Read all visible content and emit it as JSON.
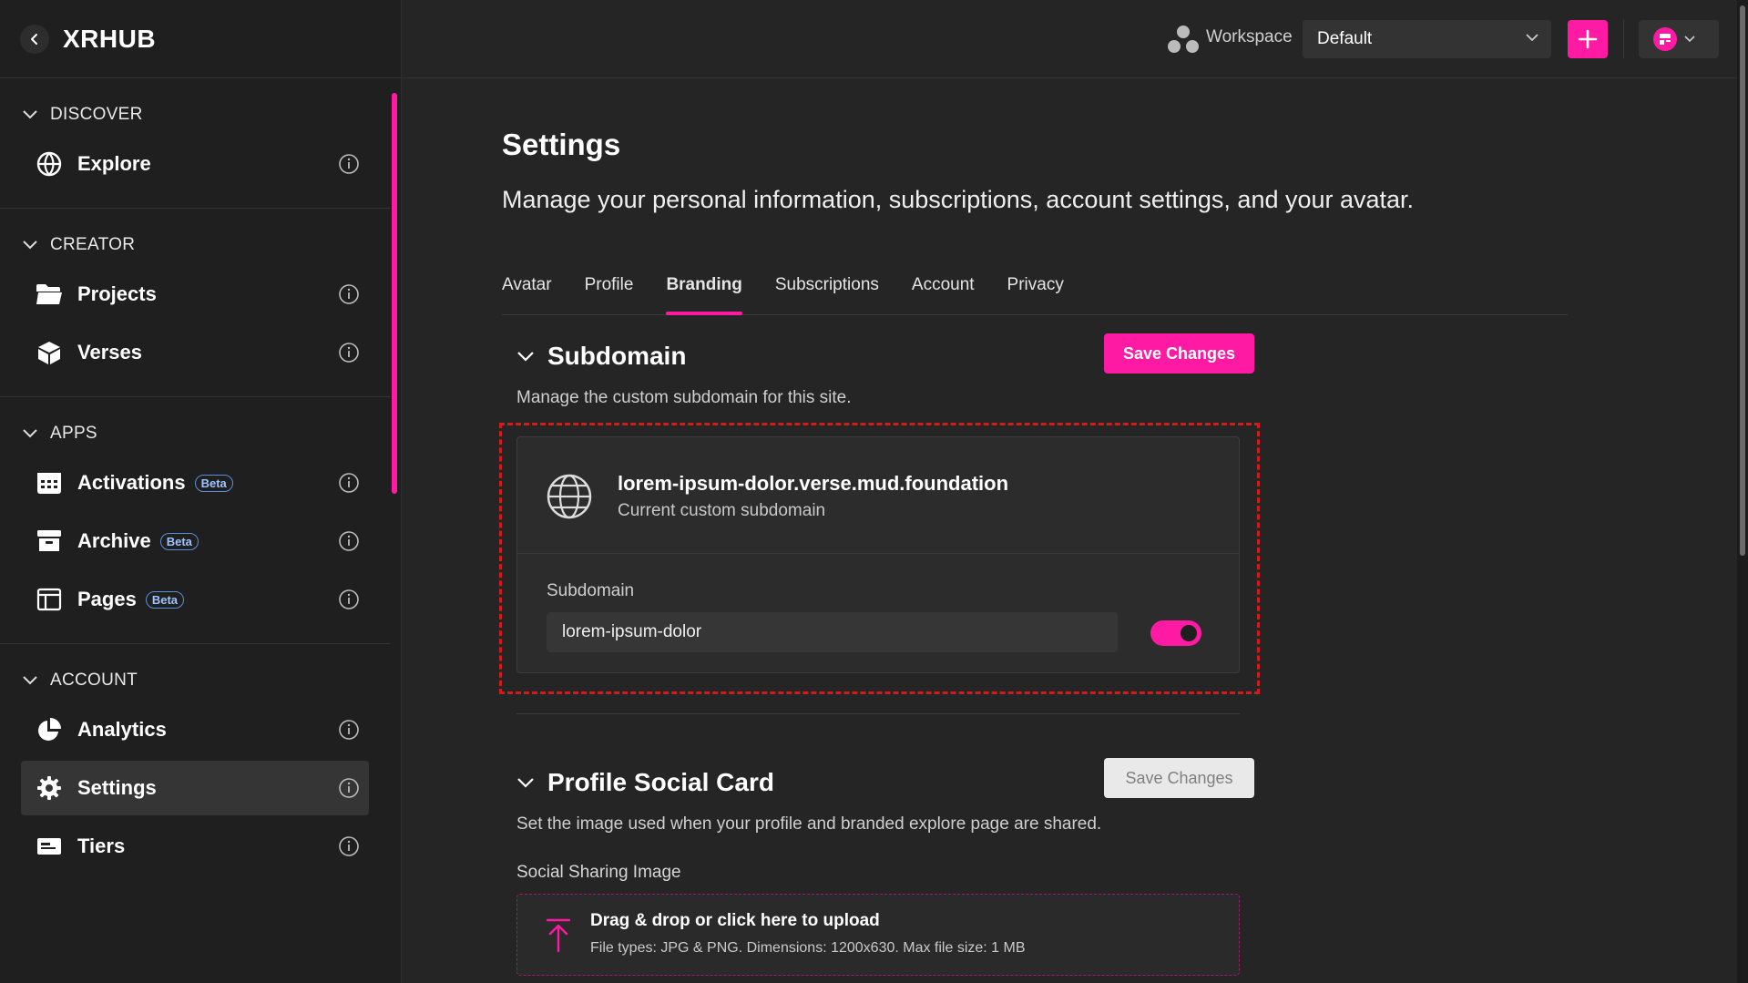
{
  "app": {
    "brand": "XRHUB"
  },
  "header": {
    "workspace_label": "Workspace",
    "workspace_value": "Default"
  },
  "sidebar": {
    "sections": [
      {
        "title": "DISCOVER",
        "items": [
          {
            "label": "Explore",
            "icon": "globe-icon"
          }
        ]
      },
      {
        "title": "CREATOR",
        "items": [
          {
            "label": "Projects",
            "icon": "folder-icon"
          },
          {
            "label": "Verses",
            "icon": "cube-icon"
          }
        ]
      },
      {
        "title": "APPS",
        "items": [
          {
            "label": "Activations",
            "icon": "calendar-grid-icon",
            "badge": "Beta"
          },
          {
            "label": "Archive",
            "icon": "archive-icon",
            "badge": "Beta"
          },
          {
            "label": "Pages",
            "icon": "layout-icon",
            "badge": "Beta"
          }
        ]
      },
      {
        "title": "ACCOUNT",
        "items": [
          {
            "label": "Analytics",
            "icon": "pie-chart-icon"
          },
          {
            "label": "Settings",
            "icon": "gear-icon",
            "active": true
          },
          {
            "label": "Tiers",
            "icon": "ticket-icon"
          }
        ]
      }
    ]
  },
  "main": {
    "title": "Settings",
    "description": "Manage your personal information, subscriptions, account settings, and your avatar.",
    "tabs": [
      {
        "label": "Avatar"
      },
      {
        "label": "Profile"
      },
      {
        "label": "Branding",
        "active": true
      },
      {
        "label": "Subscriptions"
      },
      {
        "label": "Account"
      },
      {
        "label": "Privacy"
      }
    ],
    "subdomain": {
      "heading": "Subdomain",
      "description": "Manage the custom subdomain for this site.",
      "save_label": "Save Changes",
      "current_domain": "lorem-ipsum-dolor.verse.mud.foundation",
      "current_caption": "Current custom subdomain",
      "field_label": "Subdomain",
      "field_value": "lorem-ipsum-dolor",
      "toggle_on": true
    },
    "social_card": {
      "heading": "Profile Social Card",
      "description": "Set the image used when your profile and branded explore page are shared.",
      "save_label": "Save Changes",
      "image_label": "Social Sharing Image",
      "upload_title": "Drag & drop or click here to upload",
      "upload_hint": "File types: JPG & PNG. Dimensions: 1200x630. Max file size: 1 MB"
    }
  },
  "colors": {
    "accent": "#ff1aa3",
    "background": "#252525",
    "sidebar": "#1f1f1f",
    "focus_outline": "#d21c1c",
    "beta_badge": "#5a8fdc"
  }
}
